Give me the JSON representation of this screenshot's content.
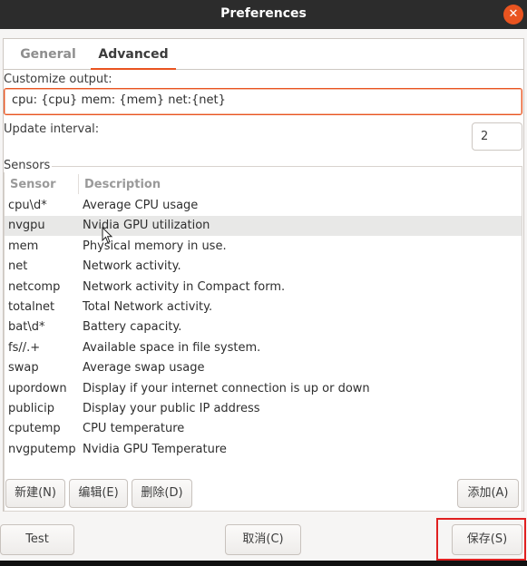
{
  "window": {
    "title": "Preferences",
    "accent_color": "#e95420",
    "close_icon": "close-icon"
  },
  "tabs": [
    {
      "label": "General",
      "active": false
    },
    {
      "label": "Advanced",
      "active": true
    }
  ],
  "output": {
    "label": "Customize output:",
    "value": "cpu: {cpu} mem: {mem} net:{net}"
  },
  "interval": {
    "label": "Update interval:",
    "value": "2"
  },
  "sensors": {
    "legend": "Sensors",
    "columns": [
      "Sensor",
      "Description"
    ],
    "rows": [
      {
        "sensor": "cpu\\d*",
        "description": "Average CPU usage"
      },
      {
        "sensor": "nvgpu",
        "description": "Nvidia GPU utilization"
      },
      {
        "sensor": "mem",
        "description": "Physical memory in use."
      },
      {
        "sensor": "net",
        "description": "Network activity."
      },
      {
        "sensor": "netcomp",
        "description": "Network activity in Compact form."
      },
      {
        "sensor": "totalnet",
        "description": "Total Network activity."
      },
      {
        "sensor": "bat\\d*",
        "description": "Battery capacity."
      },
      {
        "sensor": "fs//.+",
        "description": "Available space in file system."
      },
      {
        "sensor": "swap",
        "description": "Average swap usage"
      },
      {
        "sensor": "upordown",
        "description": "Display if your internet connection is up or down"
      },
      {
        "sensor": "publicip",
        "description": "Display your public IP address"
      },
      {
        "sensor": "cputemp",
        "description": "CPU temperature"
      },
      {
        "sensor": "nvgputemp",
        "description": "Nvidia GPU Temperature"
      }
    ],
    "selected_index": 1
  },
  "sensor_buttons": {
    "new": "新建(N)",
    "edit": "编辑(E)",
    "delete": "删除(D)",
    "add": "添加(A)"
  },
  "dialog_buttons": {
    "test": "Test",
    "cancel": "取消(C)",
    "save": "保存(S)"
  }
}
